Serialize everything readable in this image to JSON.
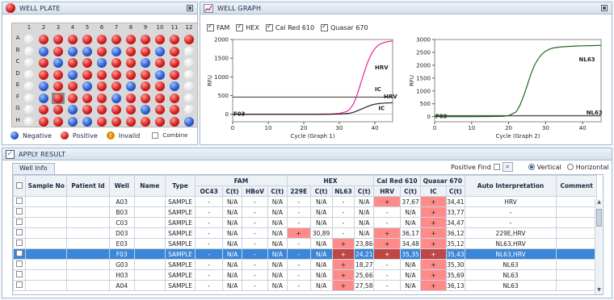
{
  "plate": {
    "title": "WELL PLATE",
    "cols": [
      "1",
      "2",
      "3",
      "4",
      "5",
      "6",
      "7",
      "8",
      "9",
      "10",
      "11",
      "12"
    ],
    "rows": [
      "A",
      "B",
      "C",
      "D",
      "E",
      "F",
      "G",
      "H"
    ],
    "wells": [
      [
        "e",
        "p",
        "p",
        "p",
        "p",
        "p",
        "p",
        "p",
        "p",
        "p",
        "p",
        "p"
      ],
      [
        "e",
        "n",
        "p",
        "n",
        "n",
        "p",
        "n",
        "p",
        "p",
        "n",
        "p",
        "e"
      ],
      [
        "e",
        "p",
        "n",
        "p",
        "p",
        "n",
        "p",
        "p",
        "n",
        "p",
        "p",
        "e"
      ],
      [
        "e",
        "p",
        "p",
        "n",
        "p",
        "p",
        "p",
        "p",
        "p",
        "n",
        "p",
        "e"
      ],
      [
        "e",
        "n",
        "p",
        "p",
        "n",
        "p",
        "p",
        "n",
        "p",
        "p",
        "n",
        "e"
      ],
      [
        "e",
        "n",
        "p",
        "p",
        "p",
        "p",
        "n",
        "p",
        "p",
        "p",
        "p",
        "e"
      ],
      [
        "e",
        "p",
        "p",
        "n",
        "p",
        "p",
        "p",
        "p",
        "n",
        "p",
        "p",
        "e"
      ],
      [
        "e",
        "p",
        "p",
        "n",
        "n",
        "p",
        "p",
        "p",
        "p",
        "p",
        "p",
        "n"
      ]
    ],
    "selected_well": "F03",
    "legend": {
      "negative": "Negative",
      "positive": "Positive",
      "invalid": "Invalid",
      "combine": "Combine"
    }
  },
  "graph": {
    "title": "WELL GRAPH",
    "channels": [
      {
        "label": "FAM",
        "checked": true
      },
      {
        "label": "HEX",
        "checked": true
      },
      {
        "label": "Cal Red 610",
        "checked": true
      },
      {
        "label": "Quasar 670",
        "checked": true
      }
    ]
  },
  "chart_data": [
    {
      "type": "line",
      "xlabel": "Cycle (Graph 1)",
      "ylabel": "RFU",
      "xlim": [
        0,
        45
      ],
      "ylim": [
        -200,
        2000
      ],
      "xticks": [
        0,
        10,
        20,
        30,
        40
      ],
      "yticks": [
        0,
        500,
        1000,
        1500,
        2000
      ],
      "well_label": "F03",
      "threshold": 460,
      "series": [
        {
          "name": "HRV",
          "color": "#e8249a",
          "x": [
            0,
            5,
            10,
            15,
            20,
            25,
            28,
            30,
            32,
            33,
            34,
            35,
            36,
            37,
            38,
            39,
            40,
            41,
            42,
            43,
            44,
            45
          ],
          "y": [
            2,
            2,
            2,
            2,
            3,
            5,
            10,
            25,
            70,
            140,
            280,
            520,
            820,
            1120,
            1400,
            1610,
            1760,
            1850,
            1900,
            1930,
            1950,
            1960
          ]
        },
        {
          "name": "IC",
          "color": "#222222",
          "x": [
            0,
            5,
            10,
            15,
            20,
            25,
            28,
            30,
            32,
            33,
            34,
            35,
            36,
            37,
            38,
            39,
            40,
            41,
            42,
            43,
            44,
            45
          ],
          "y": [
            0,
            0,
            0,
            0,
            0,
            0,
            2,
            6,
            18,
            30,
            55,
            90,
            130,
            170,
            210,
            245,
            270,
            285,
            295,
            300,
            305,
            308
          ]
        }
      ],
      "annotations": [
        {
          "text": "HRV",
          "x": 40,
          "y": 1200
        },
        {
          "text": "IC",
          "x": 40,
          "y": 620
        },
        {
          "text": "HRV",
          "x": 42.5,
          "y": 430
        },
        {
          "text": "IC",
          "x": 41,
          "y": 110
        }
      ]
    },
    {
      "type": "line",
      "xlabel": "Cycle (Graph 2)",
      "ylabel": "RFU",
      "xlim": [
        0,
        45
      ],
      "ylim": [
        -200,
        3000
      ],
      "xticks": [
        0,
        10,
        20,
        30,
        40
      ],
      "yticks": [
        0,
        500,
        1000,
        1500,
        2000,
        2500,
        3000
      ],
      "well_label": "F03",
      "threshold": 40,
      "series": [
        {
          "name": "NL63",
          "color": "#1e6b1e",
          "x": [
            0,
            5,
            10,
            15,
            18,
            20,
            22,
            23,
            24,
            25,
            26,
            27,
            28,
            29,
            30,
            31,
            32,
            34,
            36,
            38,
            40,
            42,
            45
          ],
          "y": [
            0,
            0,
            0,
            2,
            10,
            40,
            180,
            420,
            780,
            1200,
            1650,
            2000,
            2250,
            2430,
            2550,
            2620,
            2670,
            2710,
            2730,
            2745,
            2755,
            2760,
            2770
          ]
        }
      ],
      "annotations": [
        {
          "text": "NL63",
          "x": 39,
          "y": 2150
        },
        {
          "text": "NL63",
          "x": 41,
          "y": 90
        }
      ]
    }
  ],
  "result": {
    "title": "APPLY RESULT",
    "tab": "Well Info",
    "positive_find": "Positive Find",
    "vertical": "Vertical",
    "horizontal": "Horizontal",
    "group_headers": [
      "FAM",
      "HEX",
      "Cal Red 610",
      "Quasar 670"
    ],
    "headers": [
      "Sample No",
      "Patient Id",
      "Well",
      "Name",
      "Type",
      "OC43",
      "C(t)",
      "HBoV",
      "C(t)",
      "229E",
      "C(t)",
      "NL63",
      "C(t)",
      "HRV",
      "C(t)",
      "IC",
      "C(t)",
      "Auto  Interpretation",
      "Comment"
    ],
    "rows": [
      {
        "well": "A03",
        "type": "SAMPLE",
        "oc43": "-",
        "ct1": "N/A",
        "hbov": "-",
        "ct2": "N/A",
        "e229": "-",
        "ct3": "N/A",
        "nl63": "-",
        "ct4": "N/A",
        "hrv": "+",
        "ct5": "37,67",
        "ic": "+",
        "ct6": "34,41",
        "interp": "HRV"
      },
      {
        "well": "B03",
        "type": "SAMPLE",
        "oc43": "-",
        "ct1": "N/A",
        "hbov": "-",
        "ct2": "N/A",
        "e229": "-",
        "ct3": "N/A",
        "nl63": "-",
        "ct4": "N/A",
        "hrv": "-",
        "ct5": "N/A",
        "ic": "+",
        "ct6": "33,77",
        "interp": "-"
      },
      {
        "well": "C03",
        "type": "SAMPLE",
        "oc43": "-",
        "ct1": "N/A",
        "hbov": "-",
        "ct2": "N/A",
        "e229": "-",
        "ct3": "N/A",
        "nl63": "-",
        "ct4": "N/A",
        "hrv": "-",
        "ct5": "N/A",
        "ic": "+",
        "ct6": "34,47",
        "interp": "-"
      },
      {
        "well": "D03",
        "type": "SAMPLE",
        "oc43": "-",
        "ct1": "N/A",
        "hbov": "-",
        "ct2": "N/A",
        "e229": "+",
        "ct3": "30,89",
        "nl63": "-",
        "ct4": "N/A",
        "hrv": "+",
        "ct5": "36,17",
        "ic": "+",
        "ct6": "36,12",
        "interp": "229E,HRV"
      },
      {
        "well": "E03",
        "type": "SAMPLE",
        "oc43": "-",
        "ct1": "N/A",
        "hbov": "-",
        "ct2": "N/A",
        "e229": "-",
        "ct3": "N/A",
        "nl63": "+",
        "ct4": "23,86",
        "hrv": "+",
        "ct5": "34,48",
        "ic": "+",
        "ct6": "35,12",
        "interp": "NL63,HRV"
      },
      {
        "well": "F03",
        "type": "SAMPLE",
        "oc43": "-",
        "ct1": "N/A",
        "hbov": "-",
        "ct2": "N/A",
        "e229": "-",
        "ct3": "N/A",
        "nl63": "+",
        "ct4": "24,21",
        "hrv": "+",
        "ct5": "35,35",
        "ic": "+",
        "ct6": "35,43",
        "interp": "NL63,HRV",
        "selected": true
      },
      {
        "well": "G03",
        "type": "SAMPLE",
        "oc43": "-",
        "ct1": "N/A",
        "hbov": "-",
        "ct2": "N/A",
        "e229": "-",
        "ct3": "N/A",
        "nl63": "+",
        "ct4": "18,27",
        "hrv": "-",
        "ct5": "N/A",
        "ic": "+",
        "ct6": "35,30",
        "interp": "NL63"
      },
      {
        "well": "H03",
        "type": "SAMPLE",
        "oc43": "-",
        "ct1": "N/A",
        "hbov": "-",
        "ct2": "N/A",
        "e229": "-",
        "ct3": "N/A",
        "nl63": "+",
        "ct4": "25,66",
        "hrv": "-",
        "ct5": "N/A",
        "ic": "+",
        "ct6": "35,69",
        "interp": "NL63"
      },
      {
        "well": "A04",
        "type": "SAMPLE",
        "oc43": "-",
        "ct1": "N/A",
        "hbov": "-",
        "ct2": "N/A",
        "e229": "-",
        "ct3": "N/A",
        "nl63": "+",
        "ct4": "27,58",
        "hrv": "-",
        "ct5": "N/A",
        "ic": "+",
        "ct6": "36,13",
        "interp": "NL63"
      }
    ]
  }
}
